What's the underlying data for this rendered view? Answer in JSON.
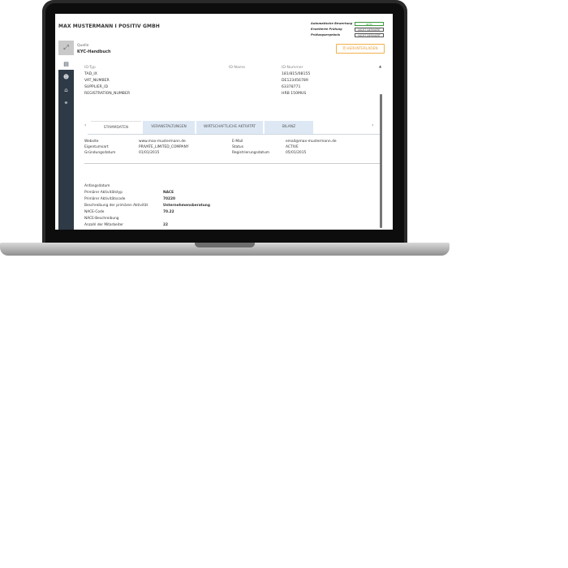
{
  "app": {
    "company": "MAX MUSTERMANN I POSITIV GMBH",
    "status": [
      {
        "label": "Automatische Bewertung",
        "value": "grün"
      },
      {
        "label": "Erweiterte Prüfung",
        "value": "NICHT DEFINIERT"
      },
      {
        "label": "Prüfungsergebnis",
        "value": "NICHT DEFINIERT"
      }
    ]
  },
  "source": {
    "collapse_icon": "expand-icon",
    "label": "Quelle",
    "value": "KYC-Handbuch",
    "download_label": "HERUNTERLADEN"
  },
  "sidebar": {
    "items": [
      {
        "icon": "document-icon"
      },
      {
        "icon": "users-icon"
      },
      {
        "icon": "bank-icon"
      },
      {
        "icon": "network-icon"
      }
    ]
  },
  "ids": {
    "headers": {
      "type": "ID-Typ",
      "name": "ID-Name",
      "number": "ID-Nummer"
    },
    "rows": [
      {
        "type": "TAD_IX",
        "number": "181/815/08155"
      },
      {
        "type": "VAT_NUMBER",
        "number": "DE123456789"
      },
      {
        "type": "SUPPLIER_ID",
        "number": "63378771"
      },
      {
        "type": "REGISTRATION_NUMBER",
        "number": "HRB 150MUS"
      }
    ]
  },
  "tabs": [
    {
      "label": "STAMMDATEN",
      "active": true
    },
    {
      "label": "VERANSTALTUNGEN",
      "active": false
    },
    {
      "label": "WIRTSCHAFTLICHE AKTIVITÄT",
      "active": false
    },
    {
      "label": "BILANZ",
      "active": false
    }
  ],
  "details": {
    "website_label": "Website",
    "website_value": "www.max-mustermann.de",
    "email_label": "E-Mail",
    "email_value": "email@max-mustermann.de",
    "ownership_label": "Eigentumsart",
    "ownership_value": "PRIVATE_LIMITED_COMPANY",
    "status_label": "Status",
    "status_value": "ACTIVE",
    "founded_label": "Gründungsdatum",
    "founded_value": "01/01/2015",
    "registered_label": "Registrierungsdatum",
    "registered_value": "05/01/2015"
  },
  "activity": {
    "start_label": "Anfangsdatum",
    "type_label": "Primärer Aktivitätstyp",
    "type_value": "NACE",
    "code_label": "Primärer Aktivitätscode",
    "code_value": "70220",
    "desc_label": "Beschreibung der primären Aktivität",
    "desc_value": "Unternehmensberatung",
    "nace_code_label": "NACE-Code",
    "nace_code_value": "70.22",
    "nace_desc_label": "NACE-Beschreibung",
    "employees_label": "Anzahl der Mitarbeiter",
    "employees_value": "22"
  }
}
